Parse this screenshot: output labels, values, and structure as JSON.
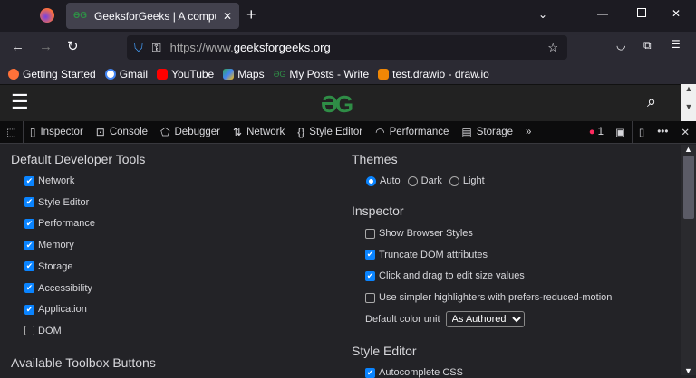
{
  "browser": {
    "tab_title": "GeeksforGeeks | A computer sci",
    "url_prefix": "https://www.",
    "url_domain": "geeksforgeeks.org",
    "bookmarks": [
      "Getting Started",
      "Gmail",
      "YouTube",
      "Maps",
      "My Posts - Write",
      "test.drawio - draw.io"
    ]
  },
  "site": {
    "logo": "GG"
  },
  "devtools": {
    "tabs": [
      "Inspector",
      "Console",
      "Debugger",
      "Network",
      "Style Editor",
      "Performance",
      "Storage"
    ],
    "error_count": "1"
  },
  "settings": {
    "default_tools": {
      "title": "Default Developer Tools",
      "items": [
        {
          "label": "Network",
          "checked": true
        },
        {
          "label": "Style Editor",
          "checked": true
        },
        {
          "label": "Performance",
          "checked": true
        },
        {
          "label": "Memory",
          "checked": true
        },
        {
          "label": "Storage",
          "checked": true
        },
        {
          "label": "Accessibility",
          "checked": true
        },
        {
          "label": "Application",
          "checked": true
        },
        {
          "label": "DOM",
          "checked": false
        }
      ]
    },
    "toolbox_title": "Available Toolbox Buttons",
    "themes": {
      "title": "Themes",
      "options": [
        "Auto",
        "Dark",
        "Light"
      ],
      "selected": "Auto"
    },
    "inspector": {
      "title": "Inspector",
      "items": [
        {
          "label": "Show Browser Styles",
          "checked": false
        },
        {
          "label": "Truncate DOM attributes",
          "checked": true
        },
        {
          "label": "Click and drag to edit size values",
          "checked": true
        },
        {
          "label": "Use simpler highlighters with prefers-reduced-motion",
          "checked": false
        }
      ],
      "color_unit_label": "Default color unit",
      "color_unit_value": "As Authored"
    },
    "style_editor": {
      "title": "Style Editor",
      "items": [
        {
          "label": "Autocomplete CSS",
          "checked": true
        }
      ]
    }
  }
}
